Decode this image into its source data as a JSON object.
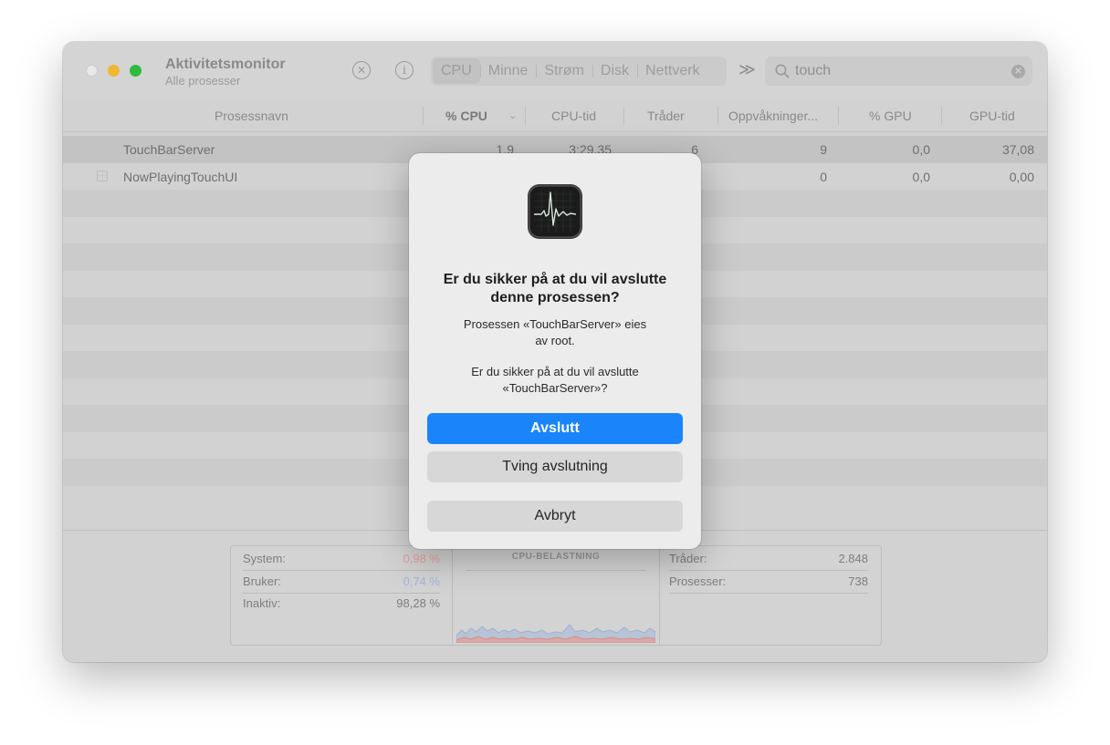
{
  "window": {
    "title": "Aktivitetsmonitor",
    "subtitle": "Alle prosesser"
  },
  "toolbar": {
    "stop_icon": "x-circle-icon",
    "info_icon": "info-circle-icon",
    "tabs": [
      {
        "label": "CPU",
        "active": true
      },
      {
        "label": "Minne",
        "active": false
      },
      {
        "label": "Strøm",
        "active": false
      },
      {
        "label": "Disk",
        "active": false
      },
      {
        "label": "Nettverk",
        "active": false
      }
    ],
    "more_icon": "double-chevron-right-icon",
    "search": {
      "value": "touch",
      "icon": "magnifying-glass-icon",
      "clear_icon": "clear-circle-icon"
    }
  },
  "table": {
    "columns": [
      "Prosessnavn",
      "% CPU",
      "CPU-tid",
      "Tråder",
      "Oppvåkninger...",
      "% GPU",
      "GPU-tid"
    ],
    "rows": [
      {
        "name": "TouchBarServer",
        "cpu": "1,9",
        "cpu_time": "3:29,35",
        "threads": "6",
        "wakeups": "9",
        "gpu": "0,0",
        "gpu_time": "37,08",
        "selected": true
      },
      {
        "name": "NowPlayingTouchUI",
        "cpu": "",
        "cpu_time": "",
        "threads": "",
        "wakeups": "0",
        "gpu": "0,0",
        "gpu_time": "0,00",
        "selected": false
      }
    ]
  },
  "summary": {
    "left": [
      {
        "label": "System:",
        "value": "0,98 %",
        "color": "#e8a09a"
      },
      {
        "label": "Bruker:",
        "value": "0,74 %",
        "color": "#9fb6dc"
      },
      {
        "label": "Inaktiv:",
        "value": "98,28 %",
        "color": "#7e7e7e"
      }
    ],
    "graph_title": "CPU-BELASTNING",
    "right": [
      {
        "label": "Tråder:",
        "value": "2.848"
      },
      {
        "label": "Prosesser:",
        "value": "738"
      }
    ]
  },
  "dialog": {
    "icon": "activity-monitor-app-icon",
    "title": "Er du sikker på at du vil avslutte denne prosessen?",
    "message_line1": "Prosessen «TouchBarServer» eies",
    "message_line2": "av root.",
    "message_line3": "Er du sikker på at du vil avslutte",
    "message_line4": "«TouchBarServer»?",
    "primary_button": "Avslutt",
    "force_button": "Tving avslutning",
    "cancel_button": "Avbryt",
    "primary_color": "#1a84fb"
  }
}
